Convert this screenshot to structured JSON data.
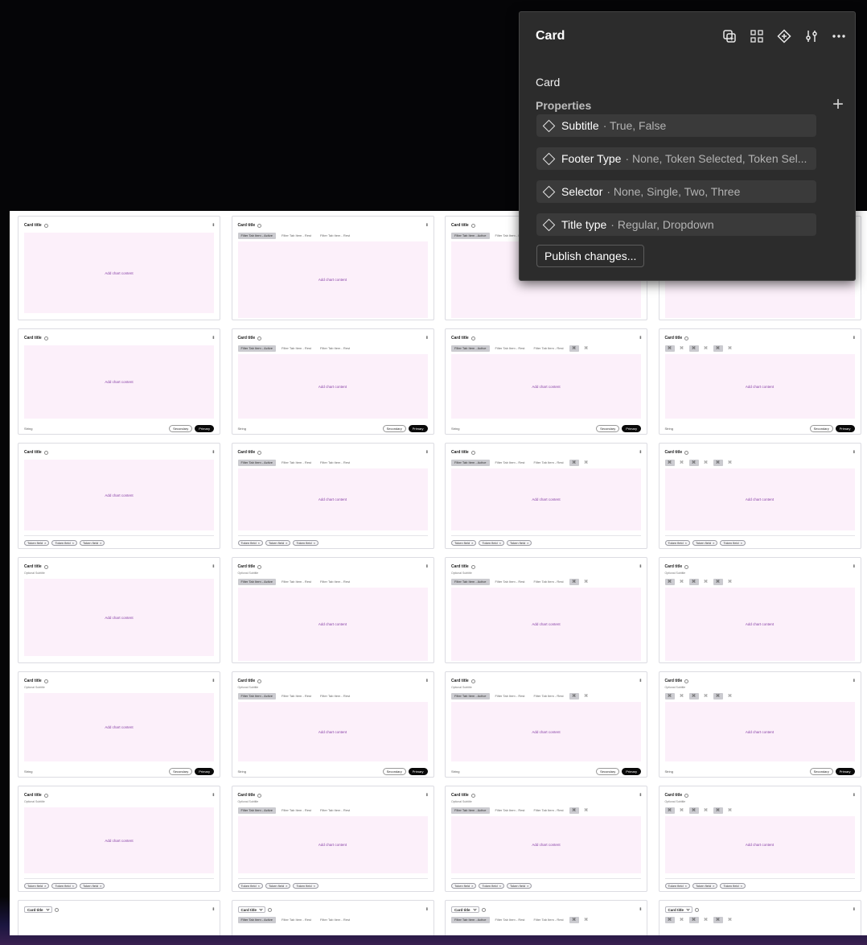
{
  "panel": {
    "title": "Card",
    "component_name": "Card",
    "properties_label": "Properties",
    "properties": [
      {
        "name": "Subtitle",
        "values": "· True, False"
      },
      {
        "name": "Footer Type",
        "values": "· None, Token Selected, Token Sel..."
      },
      {
        "name": "Selector",
        "values": "· None, Single, Two, Three"
      },
      {
        "name": "Title type",
        "values": "· Regular, Dropdown"
      }
    ],
    "publish_label": "Publish changes...",
    "icons": [
      "select-instances-icon",
      "grid-dots-icon",
      "component-diamond-icon",
      "adjust-sliders-icon",
      "more-options-icon"
    ]
  },
  "card": {
    "title": "Card title",
    "subtitle": "Optional Subtitle",
    "chart_placeholder": "Add chart content",
    "footer_string": "String",
    "secondary": "Secondary",
    "primary": "Primary",
    "token": "Token field",
    "token_x": "×",
    "tab_active": "Filter Tab Item - Active",
    "tab_rest": "Filter Tab Item - Rest",
    "icon_tab": "⌘"
  },
  "colors": {
    "panel_bg": "#2c2c2c",
    "chart_bg": "#fcf0fa",
    "chart_text": "#8a44a8",
    "primary_button": "#0a0a0a"
  }
}
